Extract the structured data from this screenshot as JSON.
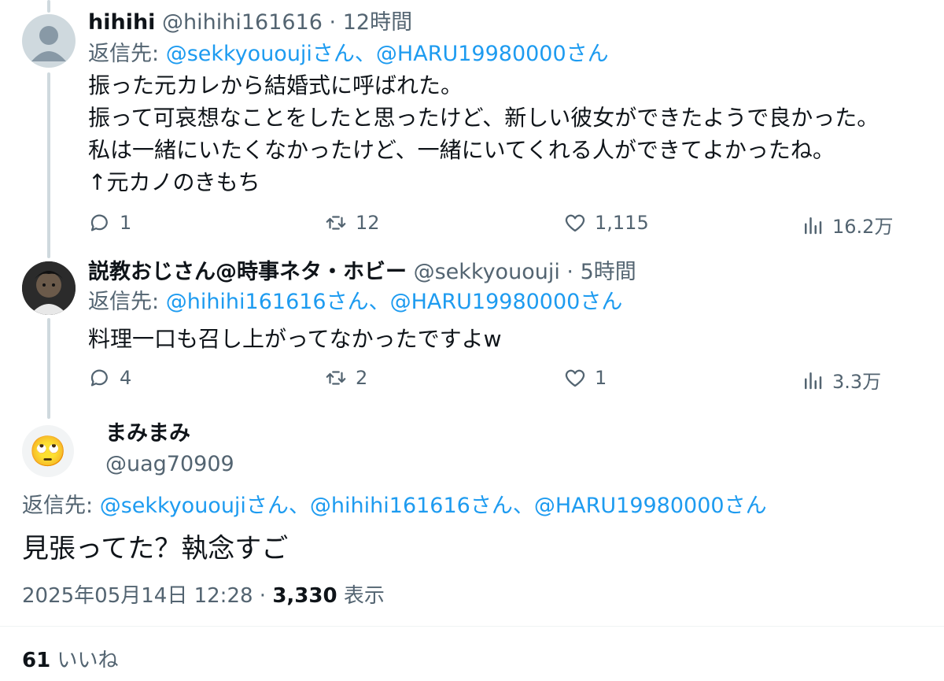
{
  "reply1": {
    "name": "hihihi",
    "handle": "@hihihi161616",
    "time": "· 12時間",
    "reply_prefix": "返信先:",
    "reply_to": "@sekkyououjiさん、@HARU19980000さん",
    "lines": [
      "振った元カレから結婚式に呼ばれた。",
      "振って可哀想なことをしたと思ったけど、新しい彼女ができたようで良かった。",
      "私は一緒にいたくなかったけど、一緒にいてくれる人ができてよかったね。",
      "↑元カノのきもち"
    ],
    "stats": {
      "replies": "1",
      "retweets": "12",
      "likes": "1,115",
      "views": "16.2万"
    }
  },
  "reply2": {
    "name": "説教おじさん@時事ネタ・ホビー",
    "handle": "@sekkyououji",
    "time": "· 5時間",
    "reply_prefix": "返信先:",
    "reply_to": "@hihihi161616さん、@HARU19980000さん",
    "lines": [
      "料理一口も召し上がってなかったですよw"
    ],
    "stats": {
      "replies": "4",
      "retweets": "2",
      "likes": "1",
      "views": "3.3万"
    }
  },
  "main": {
    "name": "まみまみ",
    "handle": "@uag70909",
    "avatar_emoji": "🙄",
    "reply_prefix": "返信先:",
    "reply_to": "@sekkyououjiさん、@hihihi161616さん、@HARU19980000さん",
    "text": "見張ってた？執念すご",
    "date": "2025年05月14日 12:28",
    "sep": "·",
    "views_count": "3,330",
    "views_label": "表示",
    "likes_count": "61",
    "likes_label": "いいね"
  },
  "icons": {
    "reply": "reply-icon",
    "retweet": "retweet-icon",
    "like": "heart-icon",
    "views": "views-chart-icon"
  },
  "colors": {
    "link": "#1d9bf0",
    "muted": "#536471",
    "thread_line": "#cfd9de"
  }
}
